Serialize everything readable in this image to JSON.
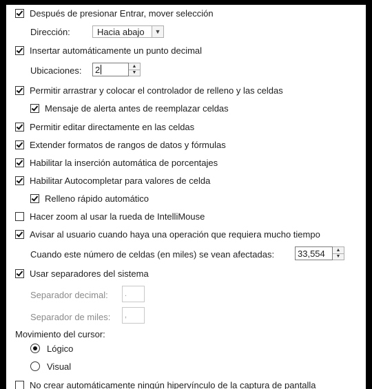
{
  "options": {
    "move_selection": {
      "label": "Después de presionar Entrar, mover selección",
      "checked": true
    },
    "direction": {
      "label": "Dirección:",
      "value": "Hacia abajo",
      "arrow": "chevron-down-icon"
    },
    "auto_decimal": {
      "label": "Insertar automáticamente un punto decimal",
      "checked": true
    },
    "places": {
      "label": "Ubicaciones:",
      "value": "2"
    },
    "fill_handle": {
      "label": "Permitir arrastrar y colocar el controlador de relleno y las celdas",
      "checked": true
    },
    "alert_overwrite": {
      "label": "Mensaje de alerta antes de reemplazar celdas",
      "checked": true
    },
    "edit_in_cell": {
      "label": "Permitir editar directamente en las celdas",
      "checked": true
    },
    "extend_formats": {
      "label": "Extender formatos de rangos de datos y fórmulas",
      "checked": true
    },
    "auto_percent": {
      "label": "Habilitar la inserción automática de porcentajes",
      "checked": true
    },
    "autocomplete": {
      "label": "Habilitar Autocompletar para valores de celda",
      "checked": true
    },
    "flash_fill": {
      "label": "Relleno rápido automático",
      "checked": true
    },
    "zoom_intellimouse": {
      "label": "Hacer zoom al usar la rueda de IntelliMouse",
      "checked": false
    },
    "alert_slow": {
      "label": "Avisar al usuario cuando haya una operación que requiera mucho tiempo",
      "checked": true
    },
    "cells_threshold": {
      "label": "Cuando este número de celdas (en miles) se vean afectadas:",
      "value": "33,554"
    },
    "system_separators": {
      "label": "Usar separadores del sistema",
      "checked": true
    },
    "decimal_sep": {
      "label": "Separador decimal:",
      "value": "."
    },
    "thousands_sep": {
      "label": "Separador de miles:",
      "value": ","
    },
    "cursor_movement": {
      "label": "Movimiento del cursor:"
    },
    "cursor_logical": {
      "label": "Lógico",
      "checked": true
    },
    "cursor_visual": {
      "label": "Visual",
      "checked": false
    },
    "no_hyperlink": {
      "label": "No crear automáticamente ningún hipervínculo de la captura de pantalla",
      "checked": false
    }
  }
}
